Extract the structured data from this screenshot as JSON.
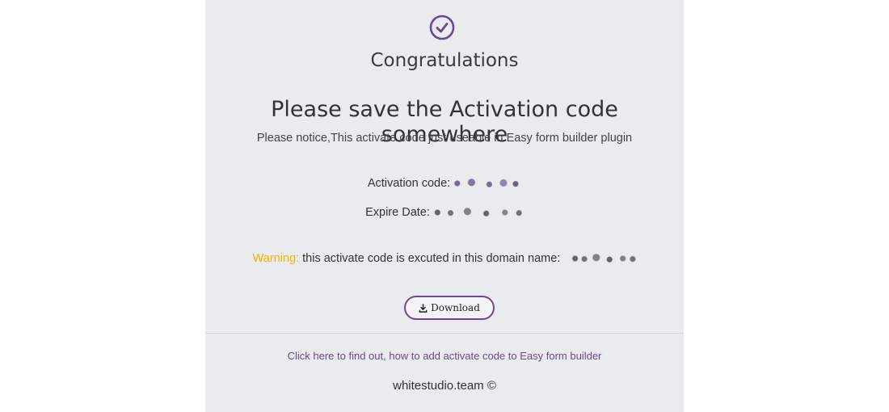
{
  "colors": {
    "accent": "#6c4a8e",
    "warning": "#f6b400",
    "card_bg": "#e9ebee"
  },
  "icons": {
    "success": "check-circle-icon",
    "download": "download-icon"
  },
  "title": "Congratulations",
  "headline": "Please save the Activation code somewhere",
  "notice": "Please notice,This activate code just useable in Easy form builder plugin",
  "activation": {
    "label": "Activation code:",
    "value_redacted": true
  },
  "expire": {
    "label": "Expire Date:",
    "value_redacted": true
  },
  "warning": {
    "label": "Warning:",
    "text": " this activate code is excuted in this domain name:",
    "domain_redacted": true
  },
  "download_button": {
    "label": "Download"
  },
  "help_link": "Click here to find out, how to add activate code to Easy form builder",
  "footer": "whitestudio.team ©"
}
